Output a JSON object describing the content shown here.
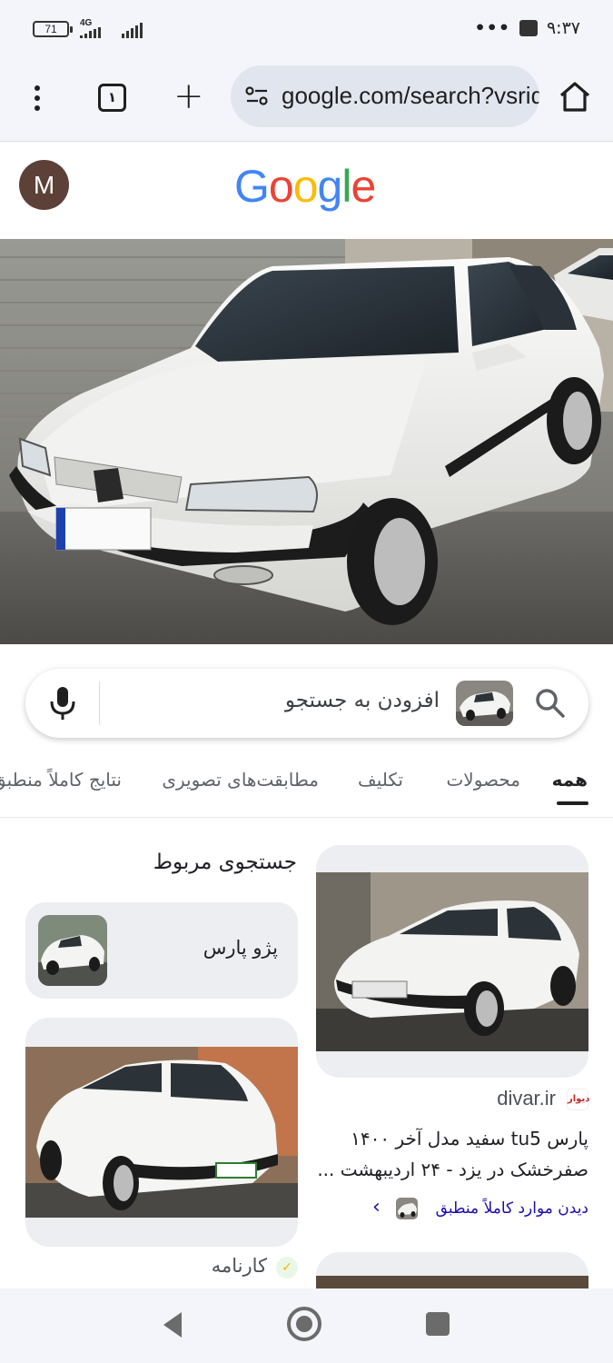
{
  "status_bar": {
    "battery": "71",
    "network": "4G",
    "overflow": "•••",
    "time": "۹:۳۷"
  },
  "browser": {
    "tab_count": "۱",
    "url": "google.com/search?vsrid=",
    "new_tab_symbol": "+"
  },
  "header": {
    "avatar_letter": "M",
    "logo_letters": [
      "G",
      "o",
      "o",
      "g",
      "l",
      "e"
    ],
    "logo_colors": [
      "#4285F4",
      "#EA4335",
      "#FBBC05",
      "#4285F4",
      "#34A853",
      "#EA4335"
    ]
  },
  "search": {
    "add_to_search": "افزودن به جستجو"
  },
  "tabs": [
    {
      "label": "همه",
      "active": true
    },
    {
      "label": "محصولات",
      "active": false
    },
    {
      "label": "تکلیف",
      "active": false
    },
    {
      "label": "مطابقت‌های تصویری",
      "active": false
    },
    {
      "label": "نتایج کاملاً منطبق",
      "active": false
    }
  ],
  "result": {
    "source": "divar.ir",
    "favicon_text": "دیوار",
    "title": "پارس tu5 سفید مدل آخر ۱۴۰۰ صفرخشک در یزد - ۲۴ اردیبهشت ...",
    "exact_match_link": "دیدن موارد کاملاً منطبق",
    "chevron": "›"
  },
  "related": {
    "heading": "جستجوی مربوط",
    "chip_label": "پژو پارس",
    "second_source": "کارنامه"
  },
  "colors": {
    "accent": "#1a0dab",
    "status_bar_bg": "#f3f5fa",
    "chip_bg": "#eceef1",
    "avatar_bg": "#5d4037"
  }
}
